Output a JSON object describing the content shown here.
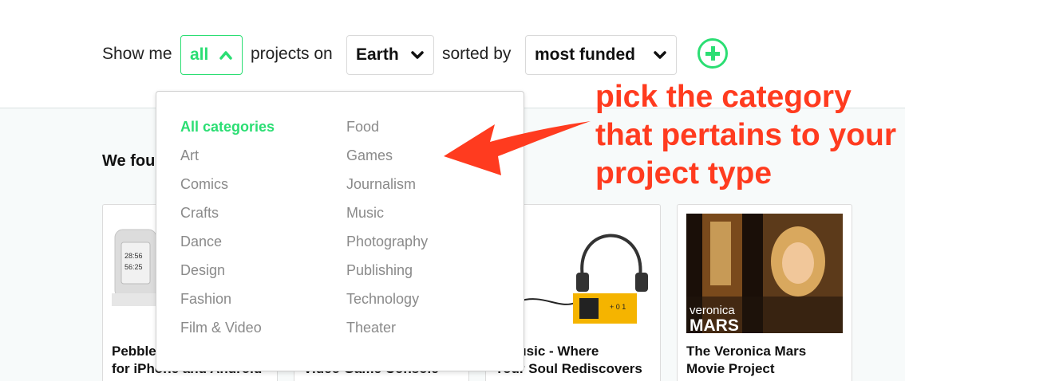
{
  "filter": {
    "show_me": "Show me",
    "category_value": "all",
    "projects_on": "projects on",
    "location_value": "Earth",
    "sorted_by": "sorted by",
    "sort_value": "most funded"
  },
  "results": {
    "found_text": "We fou",
    "cards": [
      {
        "title": "Pebble\nfor iPhone and Android"
      },
      {
        "title": "Video Game Console"
      },
      {
        "title": "o Music - Where\nYour Soul Rediscovers"
      },
      {
        "title": "The Veronica Mars\nMovie Project",
        "image_caption_top": "veronica",
        "image_caption_bottom": "MARS"
      }
    ]
  },
  "dropdown": {
    "column1": [
      "All categories",
      "Art",
      "Comics",
      "Crafts",
      "Dance",
      "Design",
      "Fashion",
      "Film & Video"
    ],
    "column2": [
      "Food",
      "Games",
      "Journalism",
      "Music",
      "Photography",
      "Publishing",
      "Technology",
      "Theater"
    ],
    "selected": "All categories"
  },
  "annotation": {
    "line1": "pick the category",
    "line2": "that pertains to your",
    "line3": "project type"
  },
  "colors": {
    "accent": "#2bde73",
    "annotation": "#ff3b1f",
    "muted_text": "#8a8a8a"
  }
}
